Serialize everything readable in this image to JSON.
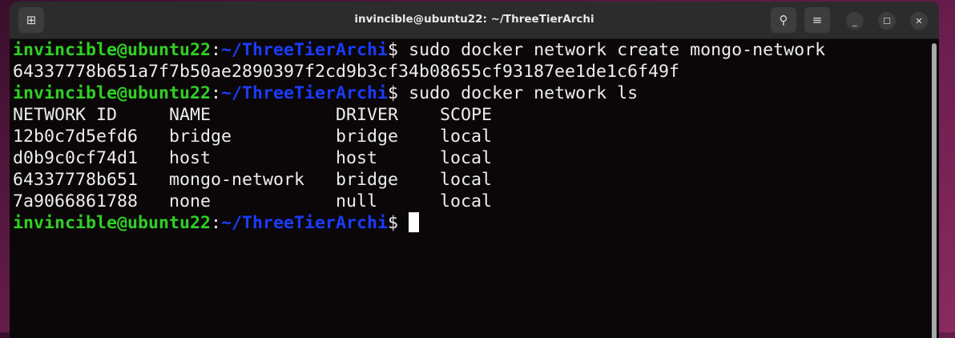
{
  "window": {
    "title": "invincible@ubuntu22: ~/ThreeTierArchi"
  },
  "icons": {
    "new_tab": "new-tab-icon",
    "search": "search-icon",
    "menu": "hamburger-menu-icon",
    "minimize": "minimize-icon",
    "maximize": "maximize-icon",
    "close": "close-icon"
  },
  "prompt": {
    "user": "invincible@ubuntu22",
    "sep": ":",
    "path": "~/ThreeTierArchi",
    "dollar": "$ "
  },
  "commands": [
    "sudo docker network create mongo-network",
    "sudo docker network ls"
  ],
  "output": {
    "network_hash": "64337778b651a7f7b50ae2890397f2cd9b3cf34b08655cf93187ee1de1c6f49f",
    "table_header": "NETWORK ID     NAME            DRIVER    SCOPE",
    "rows": [
      "12b0c7d5efd6   bridge          bridge    local",
      "d0b9c0cf74d1   host            host      local",
      "64337778b651   mongo-network   bridge    local",
      "7a9066861788   none            null      local"
    ]
  },
  "colors": {
    "prompt_user": "#2fd023",
    "prompt_path": "#1a3cff",
    "text": "#ededed"
  }
}
